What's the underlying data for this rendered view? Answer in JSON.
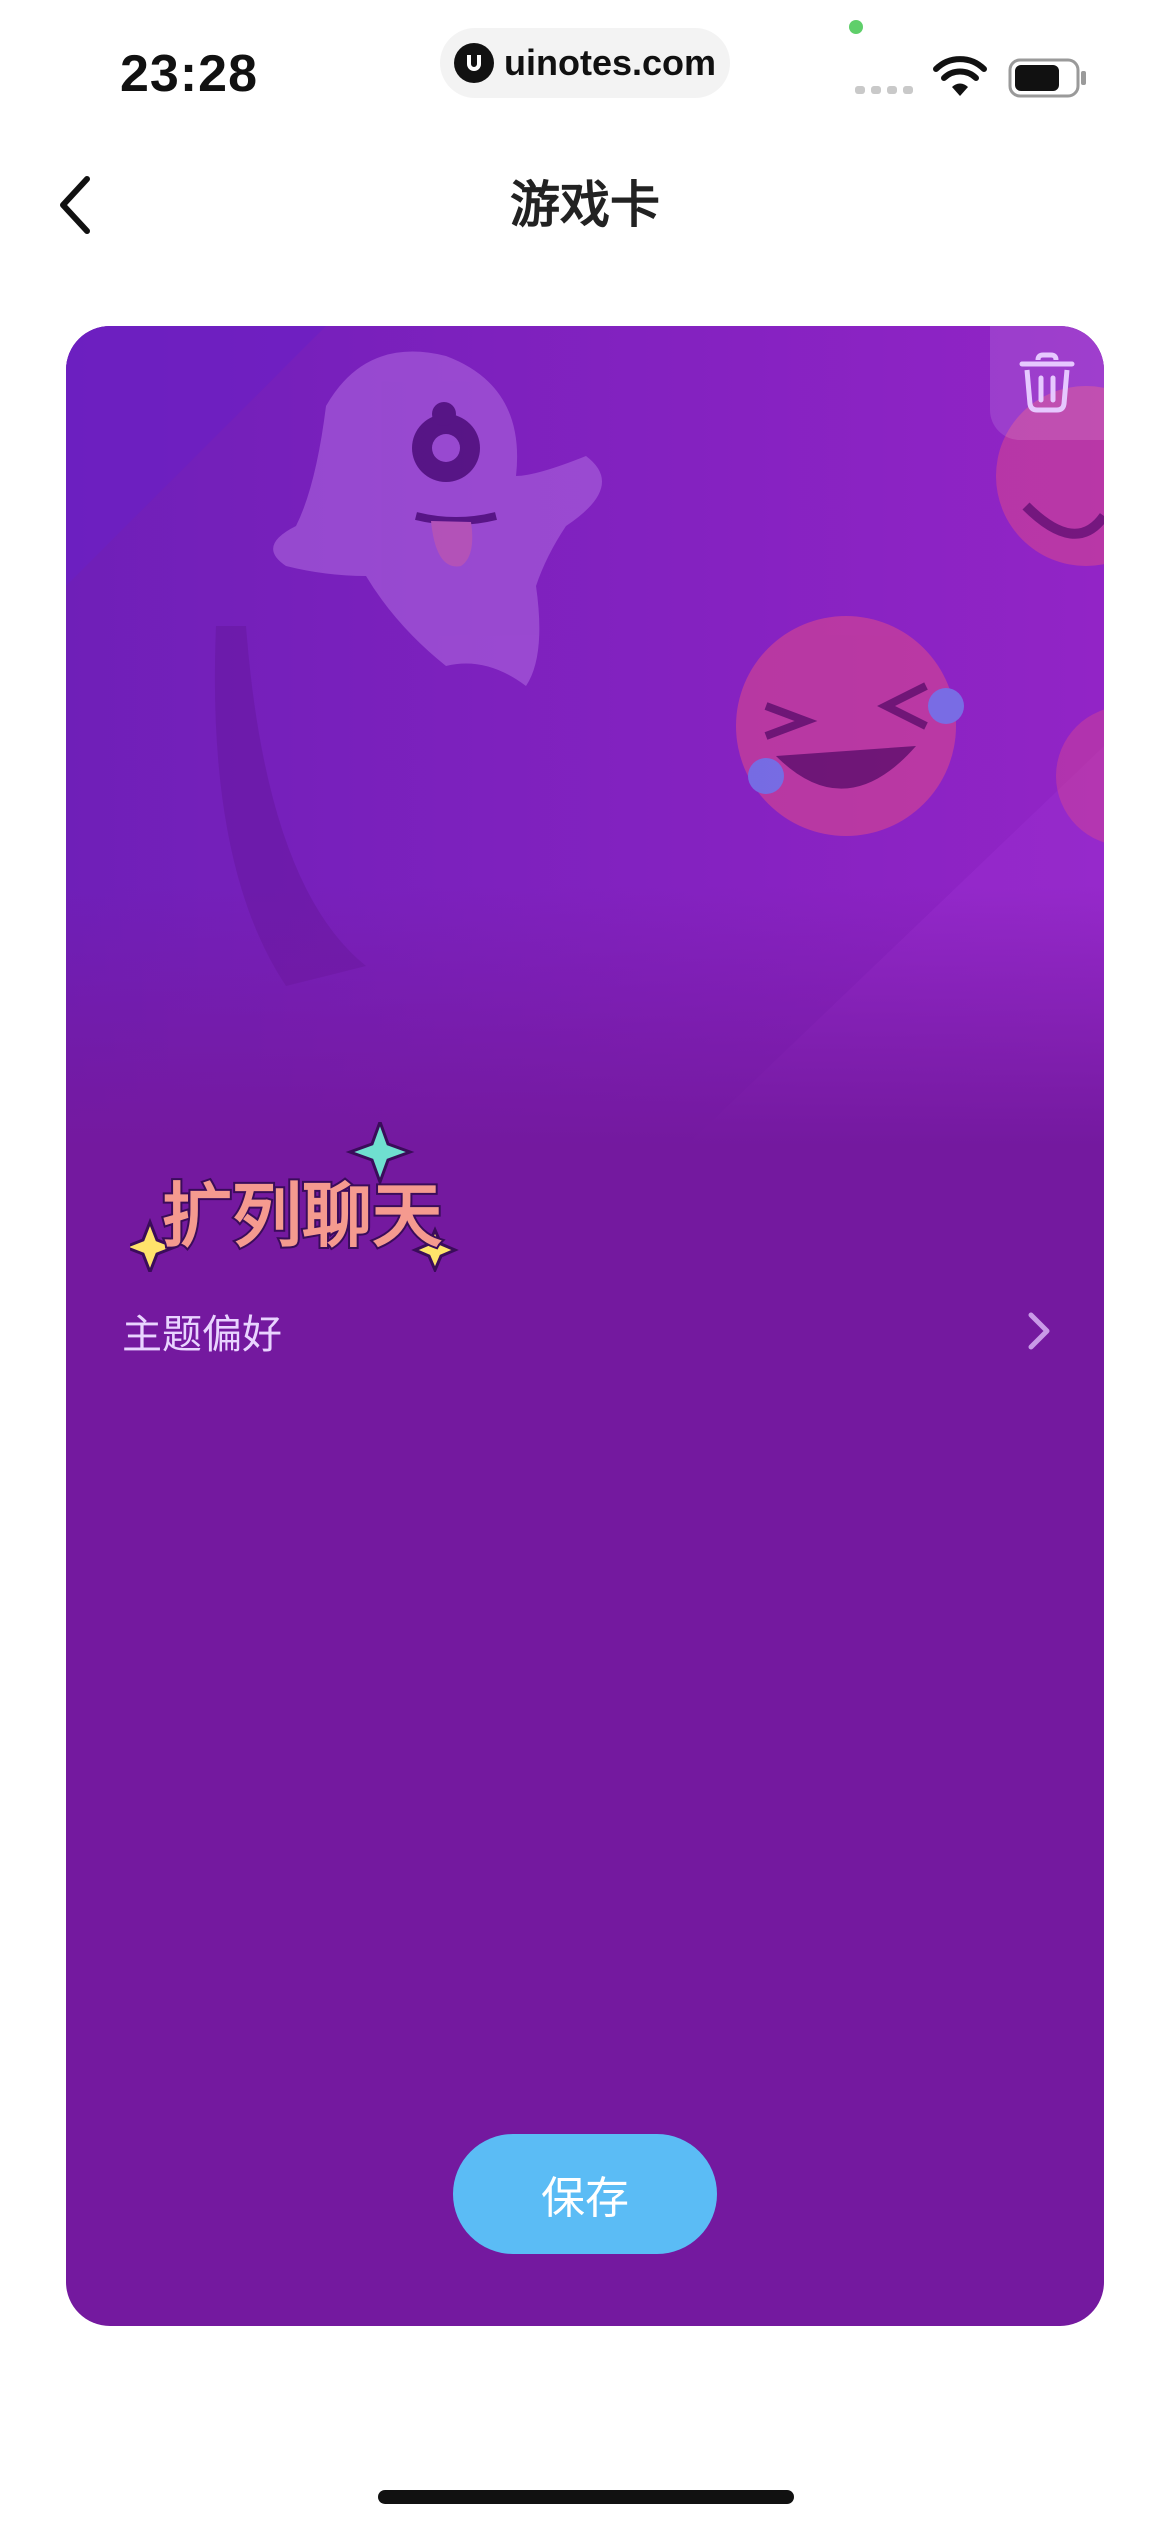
{
  "status_bar": {
    "time": "23:28",
    "url": "uinotes.com",
    "icons": [
      "signal-icon",
      "wifi-icon",
      "battery-icon"
    ]
  },
  "nav": {
    "title": "游戏卡",
    "back_icon": "chevron-left-icon"
  },
  "card": {
    "background": "#74199f",
    "delete_icon": "trash-icon",
    "logo_text": "扩列聊天",
    "theme_row": {
      "label": "主题偏好",
      "icon": "chevron-right-icon"
    },
    "save_button": {
      "label": "保存",
      "color": "#5bbcf5"
    }
  }
}
